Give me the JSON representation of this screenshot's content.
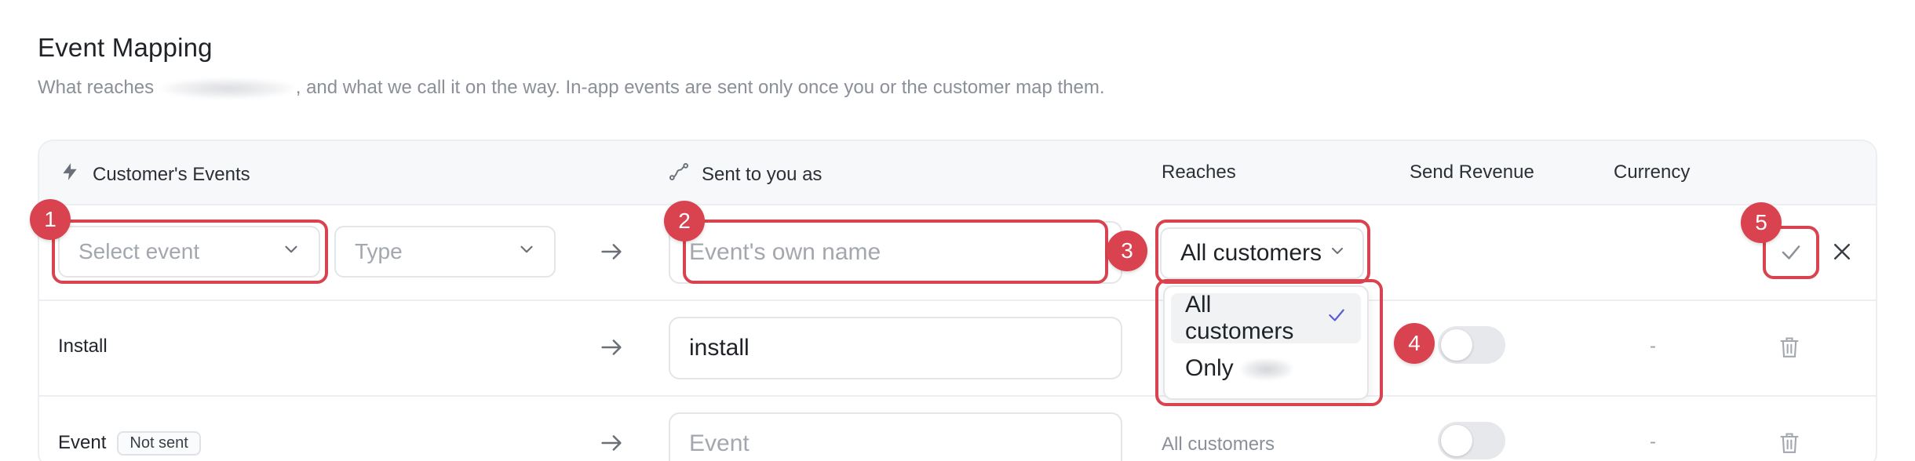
{
  "header": {
    "title": "Event Mapping",
    "subtitle_prefix": "What reaches",
    "subtitle_suffix": ", and what we call it on the way. In-app events are sent only once you or the customer map them."
  },
  "columns": {
    "customers_events": "Customer's Events",
    "sent_as": "Sent to you as",
    "reaches": "Reaches",
    "send_revenue": "Send Revenue",
    "currency": "Currency"
  },
  "new_row": {
    "event_placeholder": "Select event",
    "type_placeholder": "Type",
    "name_placeholder": "Event's own name",
    "reaches_value": "All customers"
  },
  "dropdown": {
    "options": [
      "All customers",
      "Only"
    ],
    "selected": "All customers"
  },
  "rows": [
    {
      "event": "Install",
      "sent_as": "install",
      "reaches": "",
      "revenue_on": false,
      "currency": "-"
    },
    {
      "event": "Event",
      "badge": "Not sent",
      "sent_as": "",
      "sent_as_placeholder": "Event",
      "reaches": "All customers",
      "revenue_on": false,
      "currency": "-"
    }
  ],
  "markers": [
    "1",
    "2",
    "3",
    "4",
    "5"
  ],
  "colors": {
    "highlight": "#d9434f",
    "accent_check": "#5b5bd6"
  }
}
